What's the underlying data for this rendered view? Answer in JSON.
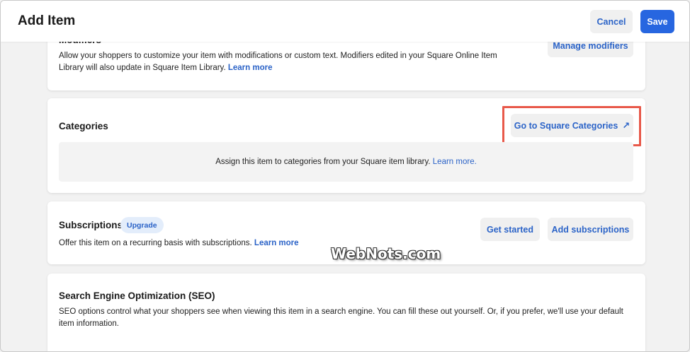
{
  "header": {
    "title": "Add Item",
    "cancel_label": "Cancel",
    "save_label": "Save"
  },
  "modifiers": {
    "title": "Modifiers",
    "description": "Allow your shoppers to customize your item with modifications or custom text. Modifiers edited in your Square Online Item Library will also update in Square Item Library.",
    "learn_more": "Learn more",
    "manage_label": "Manage modifiers"
  },
  "categories": {
    "title": "Categories",
    "goto_label": "Go to Square Categories",
    "arrow_icon": "external-arrow-icon",
    "assign_text": "Assign this item to categories from your Square item library.",
    "learn_more": "Learn more."
  },
  "subscriptions": {
    "title": "Subscriptions",
    "badge": "Upgrade",
    "description": "Offer this item on a recurring basis with subscriptions.",
    "learn_more": "Learn more",
    "get_started_label": "Get started",
    "add_label": "Add subscriptions"
  },
  "seo": {
    "title": "Search Engine Optimization (SEO)",
    "description": "SEO options control what your shoppers see when viewing this item in a search engine. You can fill these out yourself. Or, if you prefer, we'll use your default item information."
  },
  "watermark": "WebNots.com",
  "colors": {
    "primary": "#2766e0",
    "link": "#2a62c7",
    "highlight": "#e8594a"
  }
}
